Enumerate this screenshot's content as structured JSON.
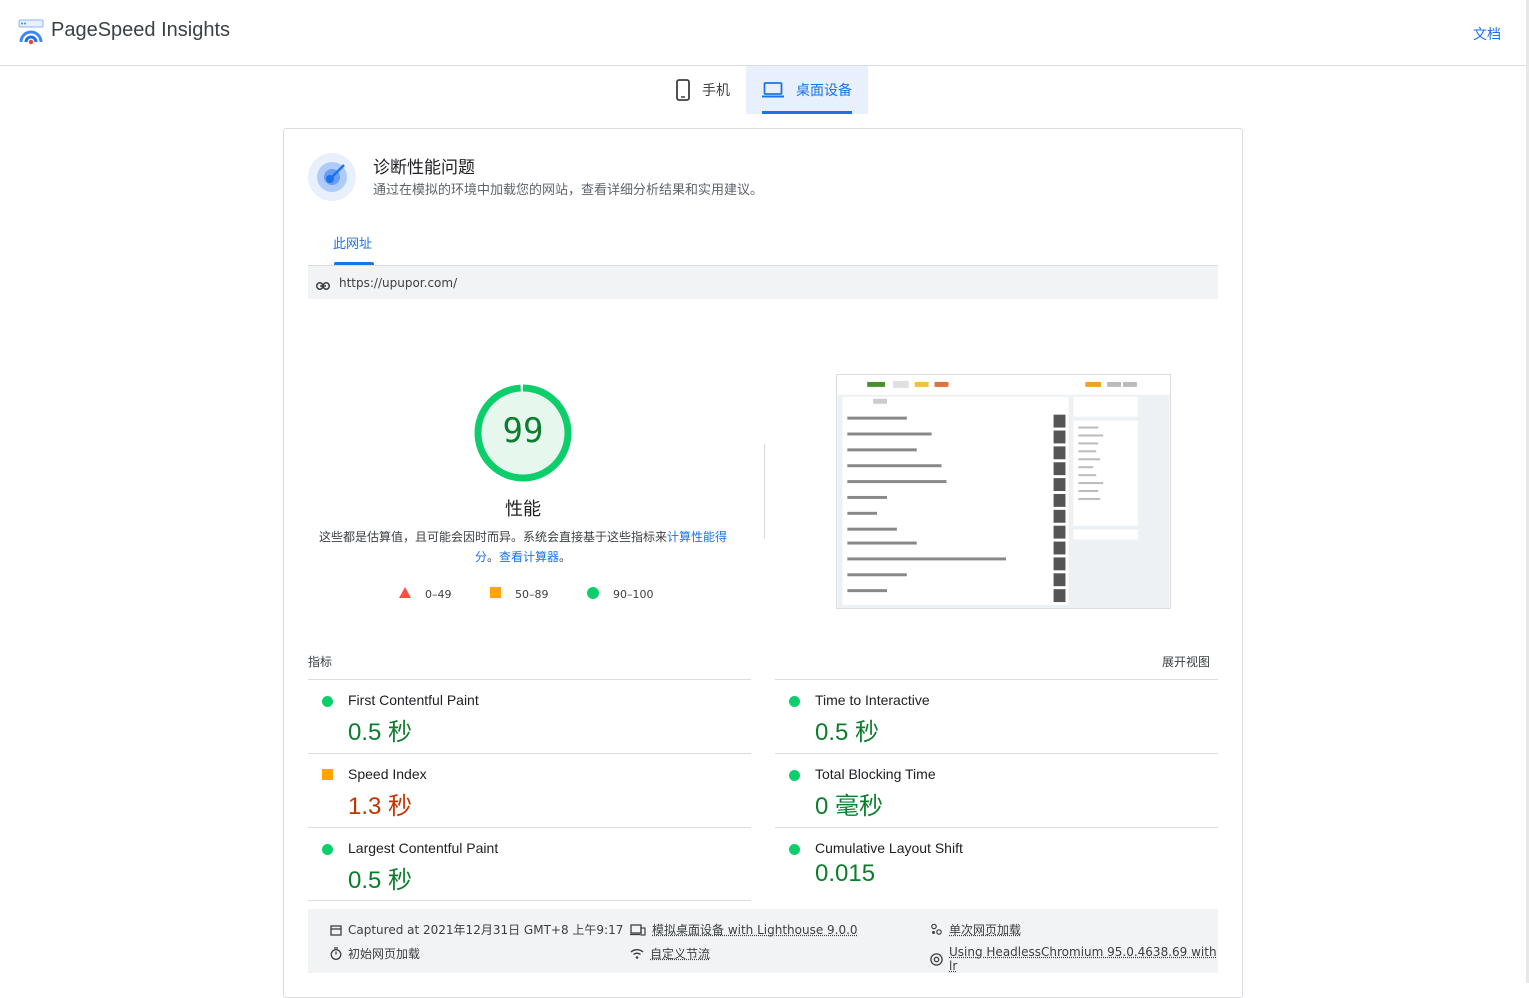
{
  "header": {
    "brand": "PageSpeed Insights",
    "docs_label": "文档"
  },
  "device_tabs": [
    {
      "label": "手机",
      "icon": "phone-icon",
      "active": false
    },
    {
      "label": "桌面设备",
      "icon": "laptop-icon",
      "active": true
    }
  ],
  "diagnose": {
    "title": "诊断性能问题",
    "subtitle": "通过在模拟的环境中加载您的网站，查看详细分析结果和实用建议。",
    "url_tab": "此网址",
    "url": "https://upupor.com/"
  },
  "score": {
    "value": 99,
    "label": "性能",
    "note_prefix": "这些都是估算值，且可能会因时而异。系统会直接基于这些指标来",
    "note_link1": "计算性能得分",
    "note_mid": "。",
    "note_link2": "查看计算器",
    "note_suffix": "。",
    "legend": [
      {
        "range": "0–49",
        "shape": "triangle",
        "color": "#ff4e42"
      },
      {
        "range": "50–89",
        "shape": "square",
        "color": "#ffa400"
      },
      {
        "range": "90–100",
        "shape": "circle",
        "color": "#0cce6b"
      }
    ]
  },
  "metrics": {
    "heading": "指标",
    "expand_label": "展开视图",
    "items": [
      {
        "name": "First Contentful Paint",
        "value": "0.5 秒",
        "status": "good"
      },
      {
        "name": "Time to Interactive",
        "value": "0.5 秒",
        "status": "good"
      },
      {
        "name": "Speed Index",
        "value": "1.3 秒",
        "status": "average"
      },
      {
        "name": "Total Blocking Time",
        "value": "0 毫秒",
        "status": "good"
      },
      {
        "name": "Largest Contentful Paint",
        "value": "0.5 秒",
        "status": "good"
      },
      {
        "name": "Cumulative Layout Shift",
        "value": "0.015",
        "status": "good"
      }
    ]
  },
  "footer": {
    "captured": "Captured at 2021年12月31日 GMT+8 上午9:17",
    "device": "模拟桌面设备 with Lighthouse 9.0.0",
    "single": "单次网页加载",
    "initial": "初始网页加载",
    "throttle": "自定义节流",
    "browser": "Using HeadlessChromium 95.0.4638.69 with lr"
  },
  "colors": {
    "accent": "#1a73e8",
    "good": "#0cce6b",
    "good_text": "#0c7d2c",
    "average": "#ffa400",
    "average_text": "#c33300",
    "poor": "#ff4e42"
  }
}
